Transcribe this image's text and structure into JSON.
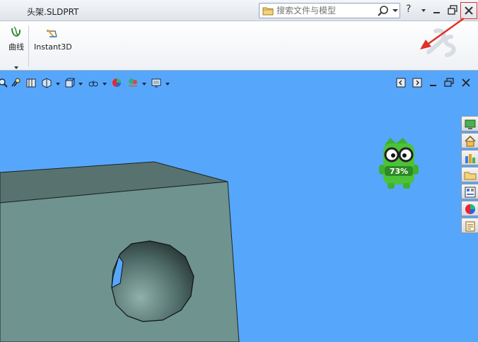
{
  "window": {
    "title": "头架.SLDPRT",
    "search_placeholder": "搜索文件与模型",
    "help_label": "?",
    "controls": [
      "minimize-icon",
      "restore-icon",
      "close-icon"
    ]
  },
  "ribbon": {
    "items": [
      {
        "label": "曲线",
        "icon": "curve-icon"
      },
      {
        "label": "Instant3D",
        "icon": "instant3d-icon"
      }
    ]
  },
  "heads_up_toolbar": {
    "icons": [
      "zoom-to-fit-icon",
      "zoom-to-area-icon",
      "previous-view-icon",
      "section-view-icon",
      "view-orientation-icon",
      "display-style-icon",
      "hide-show-items-icon",
      "edit-appearance-icon",
      "apply-scene-icon",
      "view-settings-icon"
    ]
  },
  "viewport": {
    "background_color": "#56a7fb",
    "part_color": "#6f938f",
    "window_buttons": [
      "tile-left-icon",
      "tile-right-icon",
      "minimize-icon",
      "restore-icon",
      "close-icon"
    ]
  },
  "task_pane": {
    "tabs": [
      "solidworks-resources-icon",
      "home-icon",
      "design-library-icon",
      "file-explorer-icon",
      "view-palette-icon",
      "appearances-icon",
      "custom-properties-icon"
    ]
  },
  "mascot": {
    "progress_text": "73%"
  },
  "annotation": {
    "color": "#e0302a"
  }
}
